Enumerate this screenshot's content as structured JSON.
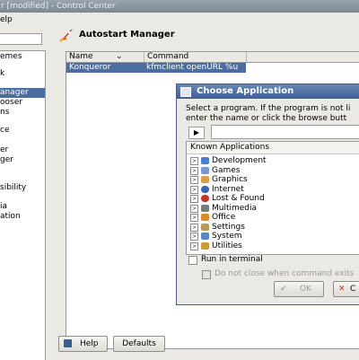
{
  "window": {
    "title": "r [modified] - Control Center"
  },
  "menubar": {
    "help": "elp"
  },
  "sidebar": {
    "items": [
      {
        "label": "emes",
        "selected": false
      },
      {
        "label": "k",
        "selected": false
      },
      {
        "label": "anager",
        "selected": true
      },
      {
        "label": "ooser",
        "selected": false
      },
      {
        "label": "ns",
        "selected": false
      },
      {
        "label": "ce",
        "selected": false
      },
      {
        "label": "er",
        "selected": false
      },
      {
        "label": "ger",
        "selected": false
      },
      {
        "label": "sibility",
        "selected": false
      },
      {
        "label": "ia",
        "selected": false
      },
      {
        "label": "ation",
        "selected": false
      }
    ]
  },
  "module": {
    "title": "Autostart Manager",
    "icon": "rocket-icon"
  },
  "list": {
    "columns": [
      "Name",
      "Command"
    ],
    "rows": [
      {
        "name": "Konqueror",
        "command": "kfmclient openURL %u"
      }
    ]
  },
  "buttons": {
    "help": "Help",
    "defaults": "Defaults"
  },
  "dialog": {
    "title": "Choose Application",
    "instruction_line1": "Select a program. If the program is not li",
    "instruction_line2": "enter the name or click the browse butt",
    "command_value": "",
    "tree_header": "Known Applications",
    "categories": [
      {
        "label": "Development",
        "icon": "development-icon",
        "color": "#4a7fd0"
      },
      {
        "label": "Games",
        "icon": "games-icon",
        "color": "#7a9ad6"
      },
      {
        "label": "Graphics",
        "icon": "graphics-icon",
        "color": "#d2a24a"
      },
      {
        "label": "Internet",
        "icon": "internet-icon",
        "color": "#3a62b5"
      },
      {
        "label": "Lost & Found",
        "icon": "lost-found-icon",
        "color": "#c0342a"
      },
      {
        "label": "Multimedia",
        "icon": "multimedia-icon",
        "color": "#7a7a7a"
      },
      {
        "label": "Office",
        "icon": "office-icon",
        "color": "#d88a2a"
      },
      {
        "label": "Settings",
        "icon": "settings-icon",
        "color": "#b89a5a"
      },
      {
        "label": "System",
        "icon": "system-icon",
        "color": "#5a88c4"
      },
      {
        "label": "Utilities",
        "icon": "utilities-icon",
        "color": "#c89a3a"
      }
    ],
    "run_in_terminal": "Run in terminal",
    "do_not_close": "Do not close when command exits",
    "ok": "OK",
    "cancel": "C"
  }
}
